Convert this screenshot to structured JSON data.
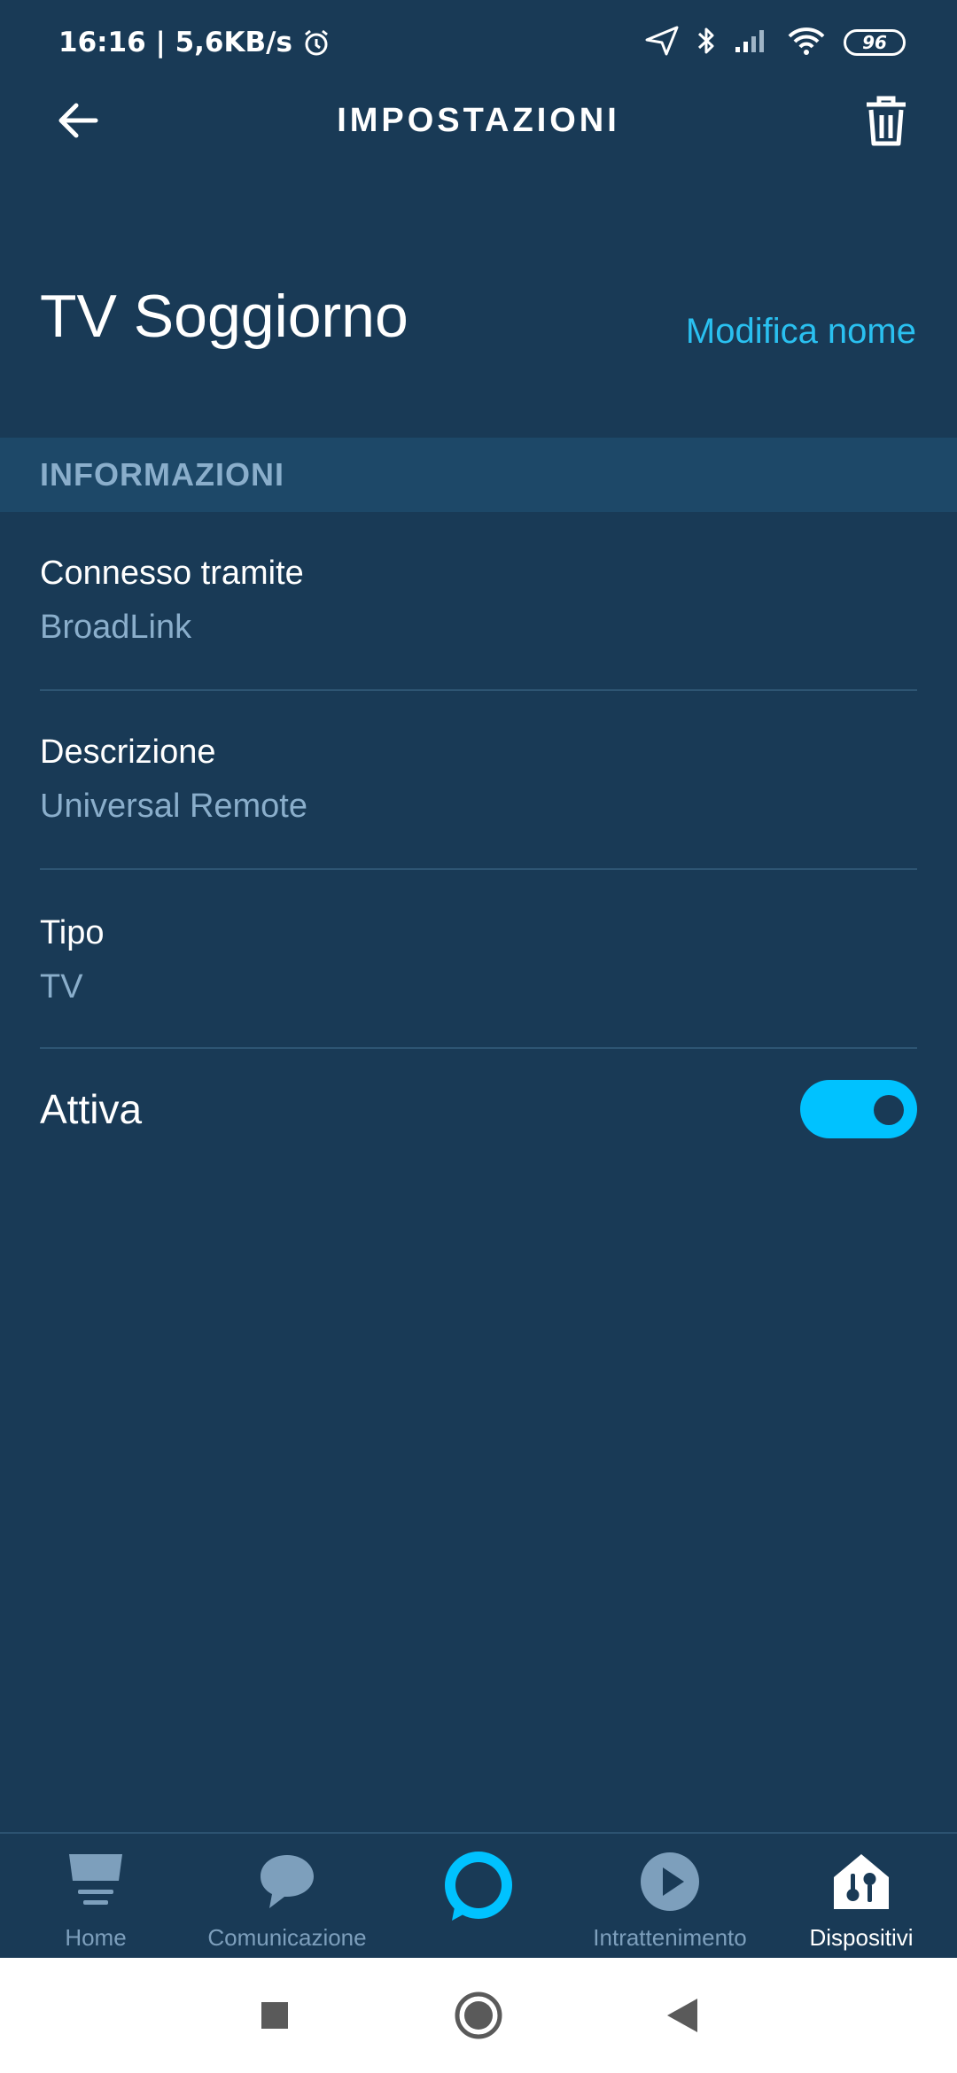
{
  "status_bar": {
    "time_speed": "16:16 | 5,6KB/s",
    "battery": "96"
  },
  "app_bar": {
    "title": "IMPOSTAZIONI"
  },
  "device": {
    "name": "TV Soggiorno",
    "edit_label": "Modifica nome"
  },
  "section": {
    "title": "INFORMAZIONI"
  },
  "info": [
    {
      "label": "Connesso tramite",
      "value": "BroadLink"
    },
    {
      "label": "Descrizione",
      "value": "Universal Remote"
    },
    {
      "label": "Tipo",
      "value": "TV"
    }
  ],
  "active": {
    "label": "Attiva",
    "enabled": true
  },
  "bottom_nav": {
    "items": [
      {
        "label": "Home"
      },
      {
        "label": "Comunicazione"
      },
      {
        "label": ""
      },
      {
        "label": "Intrattenimento"
      },
      {
        "label": "Dispositivi"
      }
    ]
  },
  "colors": {
    "background": "#193a56",
    "accent": "#00c2ff",
    "link": "#2ac0f0",
    "secondary_text": "#8aaecb",
    "section_bg": "#1d4868"
  }
}
